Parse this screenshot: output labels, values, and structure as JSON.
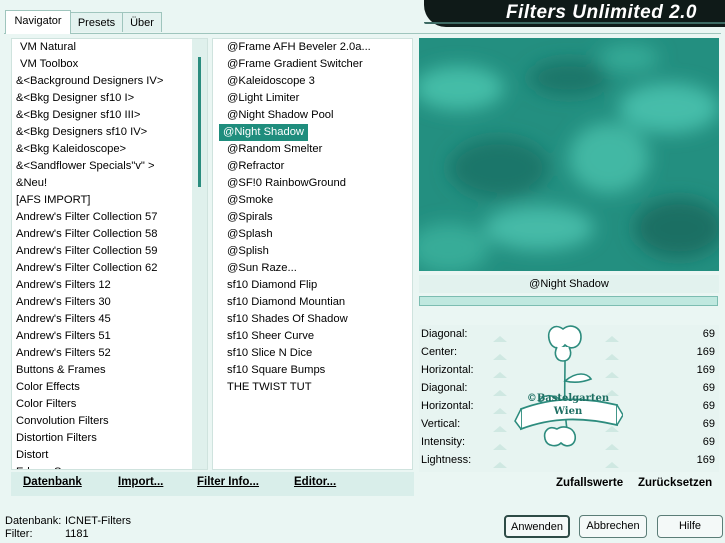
{
  "tabs": [
    "Navigator",
    "Presets",
    "Über"
  ],
  "banner_title": "Filters Unlimited 2.0",
  "categories": [
    "VM Natural",
    "VM Toolbox",
    "&<Background Designers IV>",
    "&<Bkg Designer sf10 I>",
    "&<Bkg Designer sf10 III>",
    "&<Bkg Designers sf10 IV>",
    "&<Bkg Kaleidoscope>",
    "&<Sandflower Specials\"v\" >",
    "&Neu!",
    "[AFS IMPORT]",
    "Andrew's Filter Collection 57",
    "Andrew's Filter Collection 58",
    "Andrew's Filter Collection 59",
    "Andrew's Filter Collection 62",
    "Andrew's Filters 12",
    "Andrew's Filters 30",
    "Andrew's Filters 45",
    "Andrew's Filters 51",
    "Andrew's Filters 52",
    "Buttons & Frames",
    "Color Effects",
    "Color Filters",
    "Convolution Filters",
    "Distortion Filters",
    "Distort",
    "Edges, Square"
  ],
  "categories_selected": 2,
  "filters": [
    "@Frame AFH Beveler 2.0a...",
    "@Frame Gradient Switcher",
    "@Kaleidoscope 3",
    "@Light Limiter",
    "@Night Shadow Pool",
    "@Night Shadow",
    "@Random Smelter",
    "@Refractor",
    "@SF!0 RainbowGround",
    "@Smoke",
    "@Spirals",
    "@Splash",
    "@Splish",
    "@Sun Raze...",
    "sf10 Diamond Flip",
    "sf10 Diamond Mountian",
    "sf10 Shades Of Shadow",
    "sf10 Sheer Curve",
    "sf10 Slice N Dice",
    "sf10 Square Bumps",
    "THE TWIST TUT"
  ],
  "filters_selected": 5,
  "bottom_links": [
    "Datenbank",
    "Import...",
    "Filter Info...",
    "Editor..."
  ],
  "preview_label": "@Night Shadow",
  "params": [
    {
      "label": "Diagonal:",
      "value": "69"
    },
    {
      "label": "Center:",
      "value": "169"
    },
    {
      "label": "Horizontal:",
      "value": "169"
    },
    {
      "label": "Diagonal:",
      "value": "69"
    },
    {
      "label": "Horizontal:",
      "value": "69"
    },
    {
      "label": "Vertical:",
      "value": "69"
    },
    {
      "label": "Intensity:",
      "value": "69"
    },
    {
      "label": "Lightness:",
      "value": "169"
    }
  ],
  "param_buttons": [
    "Zufallswerte",
    "Zurücksetzen"
  ],
  "watermark": {
    "line1": "©Bastelgarten",
    "line2": "Wien"
  },
  "footer": {
    "db_label": "Datenbank:",
    "db_value": "ICNET-Filters",
    "filter_label": "Filter:",
    "filter_value": "1181"
  },
  "dialog_buttons": {
    "apply": "Anwenden",
    "cancel": "Abbrechen",
    "help": "Hilfe"
  },
  "colors": {
    "accent": "#1f8d7d",
    "background": "#eaf6f3",
    "preview": "#2a9a8a"
  }
}
